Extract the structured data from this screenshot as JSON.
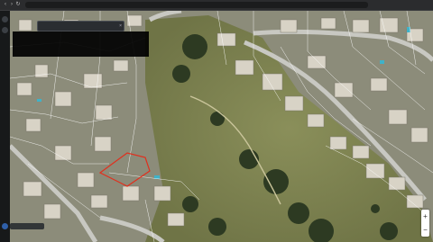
{
  "browser": {
    "url": "",
    "back_icon": "back-arrow-icon",
    "forward_icon": "forward-arrow-icon",
    "reload_icon": "reload-icon"
  },
  "search": {
    "value": "",
    "close_icon": "close-icon"
  },
  "info_panel": {
    "lines": []
  },
  "map": {
    "type": "satellite",
    "parcel_line_color": "#ffffff",
    "highlight_color": "#e0301e"
  },
  "zoom": {
    "in_label": "+",
    "out_label": "−"
  },
  "status": {
    "label": ""
  }
}
